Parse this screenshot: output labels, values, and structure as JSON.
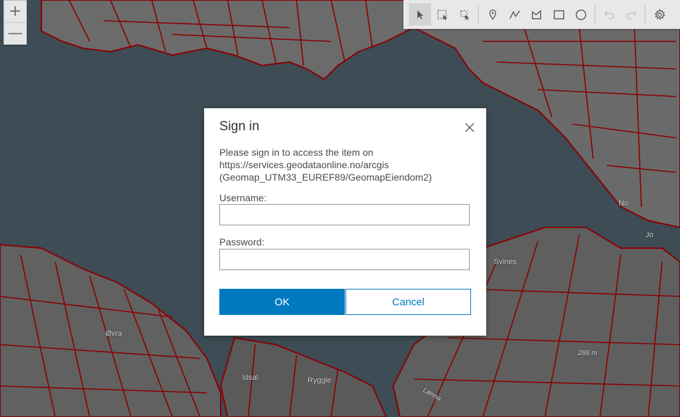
{
  "map": {
    "colors": {
      "water": "#3d4c55",
      "land": "#6a6a6a",
      "parcel": "#8b0000"
    },
    "labels": {
      "ovra": "Øvra",
      "idsal": "Idsal",
      "ryggle": "Ryggle",
      "svines": "Svines",
      "elevation": "288 m",
      "lonna": "Lønna",
      "no": "No",
      "jo": "Jo"
    }
  },
  "zoom": {
    "in_icon": "plus-icon",
    "out_icon": "minus-icon",
    "in_symbol": "+",
    "out_symbol": "—"
  },
  "toolbar": {
    "tools": [
      {
        "name": "select-pointer-icon",
        "active": true
      },
      {
        "name": "rectangle-select-icon"
      },
      {
        "name": "lasso-select-icon"
      },
      {
        "name": "point-icon"
      },
      {
        "name": "polyline-icon"
      },
      {
        "name": "polygon-icon"
      },
      {
        "name": "rectangle-icon"
      },
      {
        "name": "circle-icon"
      },
      {
        "name": "undo-icon"
      },
      {
        "name": "redo-icon"
      },
      {
        "name": "settings-icon"
      }
    ]
  },
  "dialog": {
    "title": "Sign in",
    "close_icon": "close-icon",
    "message": "Please sign in to access the item on https://services.geodataonline.no/arcgis (Geomap_UTM33_EUREF89/GeomapEiendom2)",
    "username_label": "Username:",
    "username_value": "",
    "password_label": "Password:",
    "password_value": "",
    "ok_label": "OK",
    "cancel_label": "Cancel",
    "accent_color": "#0079c1"
  }
}
